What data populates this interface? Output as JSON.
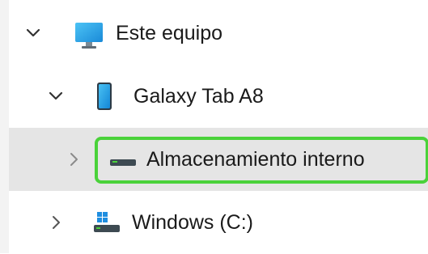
{
  "tree": {
    "items": [
      {
        "label": "Este equipo",
        "expanded": true,
        "icon": "monitor-icon"
      },
      {
        "label": "Galaxy Tab A8",
        "expanded": true,
        "icon": "tablet-icon"
      },
      {
        "label": "Almacenamiento interno",
        "expanded": false,
        "selected": true,
        "icon": "storage-drive-icon"
      },
      {
        "label": "Windows (C:)",
        "expanded": false,
        "icon": "windows-drive-icon"
      }
    ]
  },
  "colors": {
    "selection_bg": "#e5e5e5",
    "highlight_border": "#4ad23a",
    "monitor_blue": "#2aa7ea",
    "windows_blue": "#1f8ee0"
  }
}
